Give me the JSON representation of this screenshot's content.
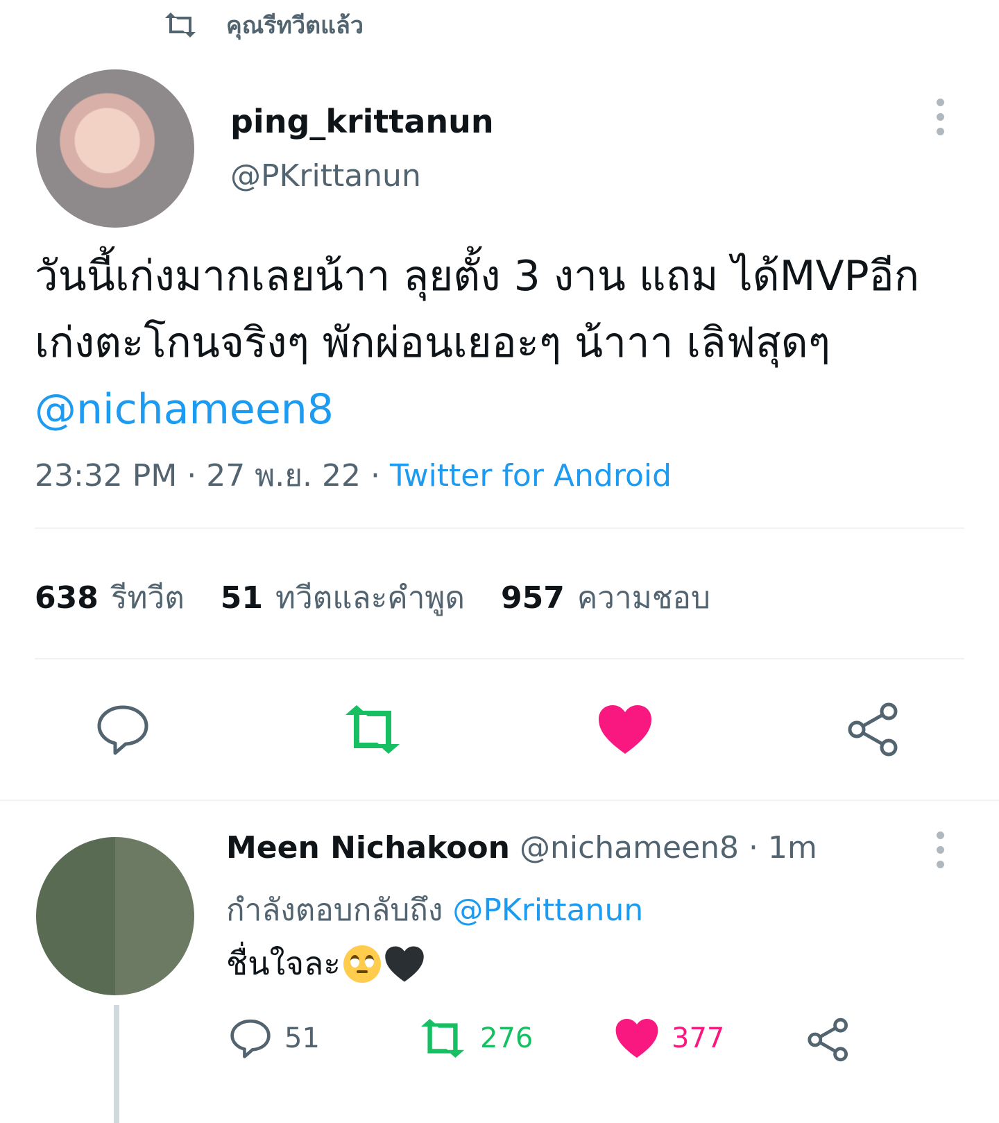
{
  "context": {
    "label": "คุณรีทวีตแล้ว"
  },
  "tweet": {
    "display_name": "ping_krittanun",
    "handle": "@PKrittanun",
    "text_main": "วันนี้เก่งมากเลยน้าา ลุยตั้ง 3 งาน แถม ได้MVPอีก เก่งตะโกนจริงๆ พักผ่อนเยอะๆ น้าาา เลิฟสุดๆ",
    "text_mention": "@nichameen8",
    "time": "23:32 PM",
    "date": "27 พ.ย. 22",
    "source": "Twitter for Android",
    "stats": {
      "retweets": {
        "count": "638",
        "label": "รีทวีต"
      },
      "quotes": {
        "count": "51",
        "label": "ทวีตและคำพูด"
      },
      "likes": {
        "count": "957",
        "label": "ความชอบ"
      }
    }
  },
  "reply": {
    "display_name": "Meen Nichakoon",
    "handle": "@nichameen8",
    "time": "1m",
    "replying_label": "กำลังตอบกลับถึง",
    "replying_to": "@PKrittanun",
    "text": "ชื่นใจละ",
    "emoji": [
      "face-with-rolling-eyes",
      "black-heart"
    ],
    "counts": {
      "replies": "51",
      "retweets": "276",
      "likes": "377"
    }
  },
  "colors": {
    "accent": "#1d9bf0",
    "retweet_active": "#17bf63",
    "like_active": "#f91880",
    "muted": "#536471"
  }
}
